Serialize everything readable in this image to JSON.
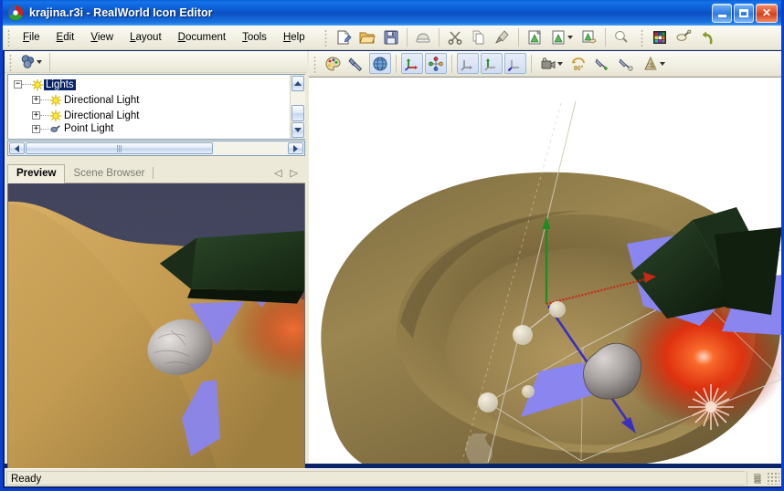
{
  "window": {
    "title": "krajina.r3i - RealWorld Icon Editor",
    "app_icon": "realworld-logo-icon",
    "minimize_label": "Minimize",
    "maximize_label": "Maximize",
    "close_label": "Close"
  },
  "menubar": {
    "items": [
      {
        "label": "File",
        "accel": "F"
      },
      {
        "label": "Edit",
        "accel": "E"
      },
      {
        "label": "View",
        "accel": "V"
      },
      {
        "label": "Layout",
        "accel": "L"
      },
      {
        "label": "Document",
        "accel": "D"
      },
      {
        "label": "Tools",
        "accel": "T"
      },
      {
        "label": "Help",
        "accel": "H"
      }
    ]
  },
  "main_toolbar": {
    "buttons": [
      {
        "name": "new-document-icon",
        "tooltip": "New"
      },
      {
        "name": "open-folder-icon",
        "tooltip": "Open"
      },
      {
        "name": "save-floppy-icon",
        "tooltip": "Save"
      },
      {
        "name": "print-icon",
        "tooltip": "Print"
      },
      {
        "name": "cut-scissors-icon",
        "tooltip": "Cut"
      },
      {
        "name": "copy-pages-icon",
        "tooltip": "Copy"
      },
      {
        "name": "paste-brush-icon",
        "tooltip": "Paste"
      },
      {
        "name": "add-image-icon",
        "tooltip": "Add Image"
      },
      {
        "name": "image-format-icon",
        "tooltip": "Image Format",
        "has_dropdown": true
      },
      {
        "name": "apply-image-icon",
        "tooltip": "Apply"
      },
      {
        "name": "bulb-icon",
        "tooltip": "Effects"
      },
      {
        "name": "palette-grid-icon",
        "tooltip": "Palette"
      },
      {
        "name": "eyedropper-icon",
        "tooltip": "Pick Color"
      },
      {
        "name": "undo-arrow-icon",
        "tooltip": "Undo"
      }
    ]
  },
  "viewport_toolbar": {
    "buttons": [
      {
        "name": "color-palette-icon",
        "tooltip": "Materials",
        "pressed": false
      },
      {
        "name": "flashlight-icon",
        "tooltip": "Light",
        "pressed": false
      },
      {
        "name": "globe-icon",
        "tooltip": "Environment",
        "pressed": true
      },
      {
        "name": "move-axis-icon",
        "tooltip": "Move",
        "pressed": true
      },
      {
        "name": "scale-nodes-icon",
        "tooltip": "Scale",
        "pressed": true
      },
      {
        "name": "axis-x-icon",
        "tooltip": "X Axis",
        "pressed": true
      },
      {
        "name": "axis-y-icon",
        "tooltip": "Y Axis",
        "pressed": true
      },
      {
        "name": "axis-z-icon",
        "tooltip": "Z Axis",
        "pressed": true
      },
      {
        "name": "camera-icon",
        "tooltip": "Camera",
        "has_dropdown": true
      },
      {
        "name": "rotate-90-icon",
        "tooltip": "Rotate 90",
        "label": "90°"
      },
      {
        "name": "add-light-icon",
        "tooltip": "Add Light"
      },
      {
        "name": "remove-light-icon",
        "tooltip": "Remove Light"
      },
      {
        "name": "gradient-cone-icon",
        "tooltip": "Gradient",
        "has_dropdown": true
      }
    ]
  },
  "left_panel": {
    "toolbar": {
      "buttons": [
        {
          "name": "objects-icon",
          "tooltip": "Objects",
          "has_dropdown": true
        }
      ]
    },
    "tree": {
      "nodes": [
        {
          "label": "Lights",
          "icon": "sun-light-icon",
          "expander": "-",
          "depth": 0,
          "selected": true
        },
        {
          "label": "Directional Light",
          "icon": "sun-light-icon",
          "expander": "+",
          "depth": 1,
          "selected": false
        },
        {
          "label": "Directional Light",
          "icon": "sun-light-icon",
          "expander": "+",
          "depth": 1,
          "selected": false
        },
        {
          "label": "Point Light",
          "icon": "point-light-icon",
          "expander": "+",
          "depth": 1,
          "selected": false
        }
      ]
    },
    "tabs": [
      {
        "label": "Preview",
        "active": true
      },
      {
        "label": "Scene Browser",
        "active": false
      }
    ],
    "tab_nav": {
      "prev": "◁",
      "next": "▷"
    }
  },
  "statusbar": {
    "text": "Ready",
    "icon": "resize-grip-icon",
    "right_icon": "stack-icon"
  },
  "scene": {
    "preview_name": "krajina-terrain-preview",
    "viewport_name": "3d-scene-viewport",
    "gizmo": {
      "axis_x_color": "#c42a16",
      "axis_y_color": "#1f8b1f",
      "axis_z_color": "#3b2fbf"
    },
    "watermark": "realworld-watermark-icon",
    "colors": {
      "terrain": "#8e7a45",
      "sky": "#3e4260",
      "cone_green": "#223a22",
      "cone_blue": "#8a85ef",
      "point_light_red": "#e81c05",
      "rock_gray": "#9a9a9a",
      "title_blue": "#0b57d0",
      "selection_blue": "#0a246a",
      "window_face": "#ece9d8"
    }
  }
}
